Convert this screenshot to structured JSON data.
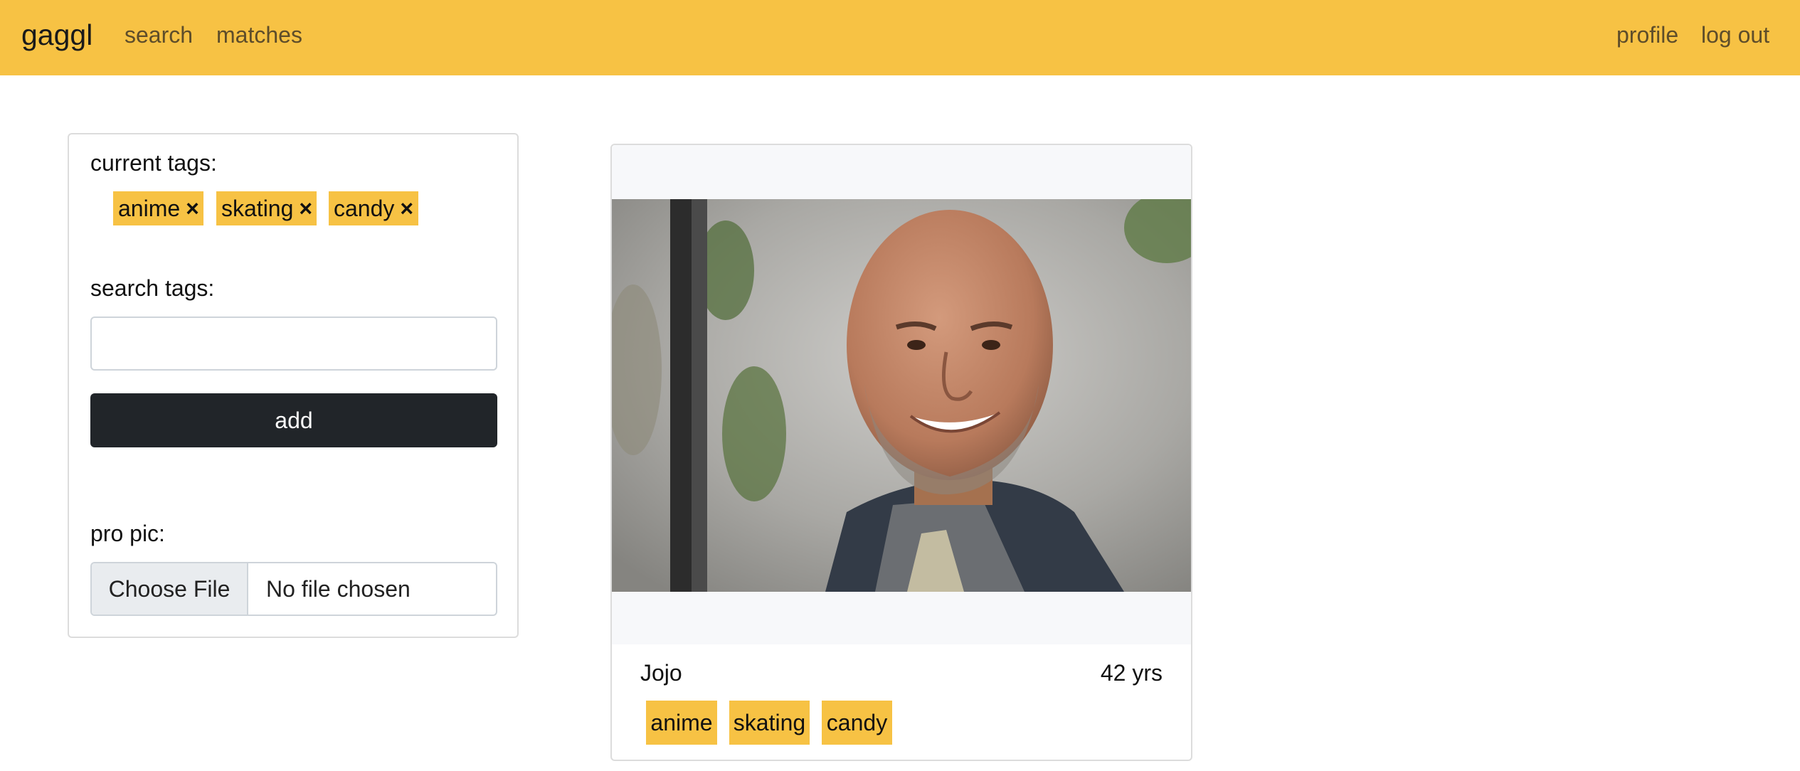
{
  "navbar": {
    "brand": "gaggl",
    "links": [
      "search",
      "matches"
    ],
    "right_links": [
      "profile",
      "log out"
    ],
    "color": "#f7c244"
  },
  "sidebar": {
    "current_tags_label": "current tags:",
    "current_tags": [
      "anime",
      "skating",
      "candy"
    ],
    "remove_icon": "×",
    "search_tags_label": "search tags:",
    "search_input_value": "",
    "add_button": "add",
    "pro_pic_label": "pro pic:",
    "file_button": "Choose File",
    "file_status": "No file chosen"
  },
  "card": {
    "photo": "profile-photo",
    "name": "Jojo",
    "age": "42 yrs",
    "tags": [
      "anime",
      "skating",
      "candy"
    ]
  }
}
